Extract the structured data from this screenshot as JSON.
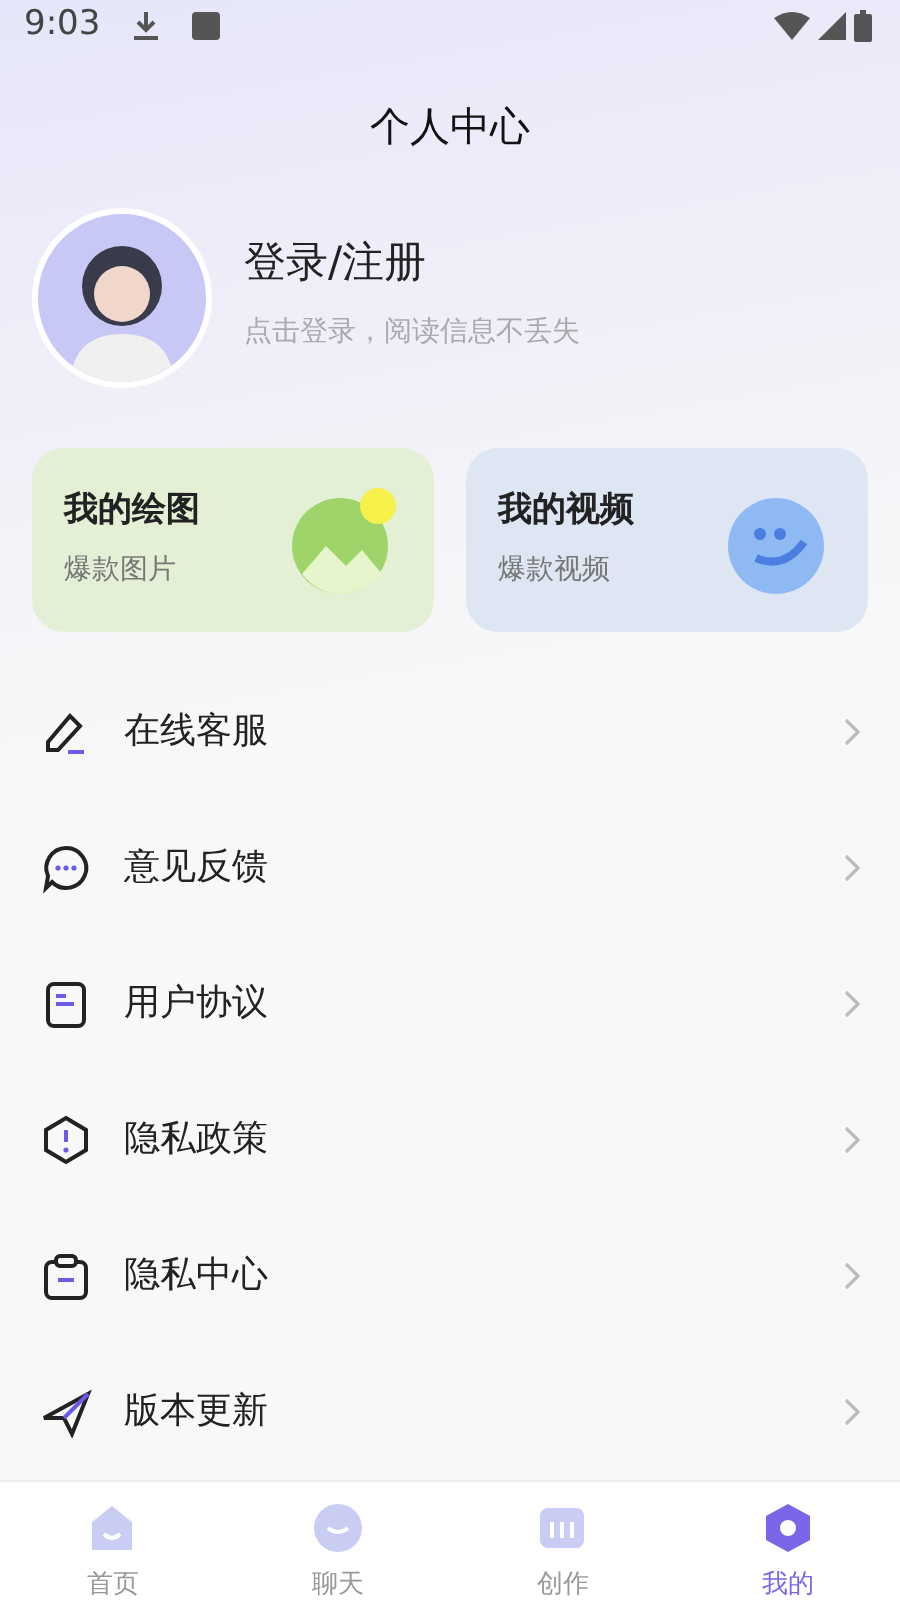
{
  "status_bar": {
    "time": "9:03"
  },
  "title": "个人中心",
  "profile": {
    "name": "登录/注册",
    "hint": "点击登录，阅读信息不丢失"
  },
  "cards": [
    {
      "kind": "drawing",
      "title": "我的绘图",
      "subtitle": "爆款图片"
    },
    {
      "kind": "video",
      "title": "我的视频",
      "subtitle": "爆款视频"
    }
  ],
  "menu": [
    {
      "kind": "support",
      "label": "在线客服"
    },
    {
      "kind": "feedback",
      "label": "意见反馈"
    },
    {
      "kind": "agreement",
      "label": "用户协议"
    },
    {
      "kind": "policy",
      "label": "隐私政策"
    },
    {
      "kind": "privacy",
      "label": "隐私中心"
    },
    {
      "kind": "update",
      "label": "版本更新"
    }
  ],
  "tabs": [
    {
      "kind": "home",
      "label": "首页",
      "selected": false
    },
    {
      "kind": "chat",
      "label": "聊天",
      "selected": false
    },
    {
      "kind": "create",
      "label": "创作",
      "selected": false
    },
    {
      "kind": "me",
      "label": "我的",
      "selected": true
    }
  ]
}
